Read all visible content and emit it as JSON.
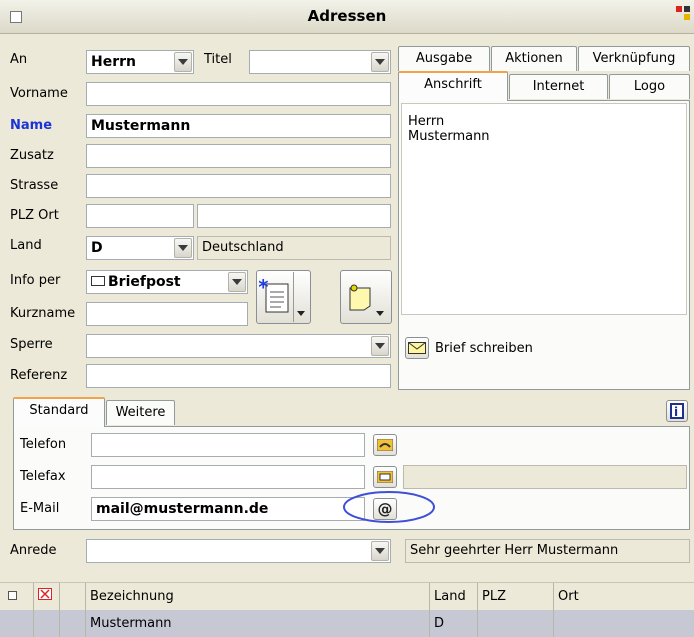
{
  "window": {
    "title": "Adressen"
  },
  "form": {
    "an_label": "An",
    "an_value": "Herrn",
    "titel_label": "Titel",
    "titel_value": "",
    "vorname_label": "Vorname",
    "vorname_value": "",
    "name_label": "Name",
    "name_value": "Mustermann",
    "zusatz_label": "Zusatz",
    "zusatz_value": "",
    "strasse_label": "Strasse",
    "strasse_value": "",
    "plzort_label": "PLZ  Ort",
    "plz_value": "",
    "ort_value": "",
    "land_label": "Land",
    "land_code": "D",
    "land_name": "Deutschland",
    "infoper_label": "Info per",
    "infoper_value": "Briefpost",
    "kurzname_label": "Kurzname",
    "kurzname_value": "",
    "sperre_label": "Sperre",
    "sperre_value": "",
    "referenz_label": "Referenz",
    "referenz_value": ""
  },
  "right_tabs": {
    "row1": [
      "Ausgabe",
      "Aktionen",
      "Verknüpfung"
    ],
    "row2": [
      "Anschrift",
      "Internet",
      "Logo"
    ],
    "address_lines": [
      "Herrn",
      "Mustermann"
    ],
    "brief_button": "Brief schreiben"
  },
  "contact": {
    "tabs": [
      "Standard",
      "Weitere"
    ],
    "telefon_label": "Telefon",
    "telefon_value": "",
    "telefax_label": "Telefax",
    "telefax_value": "",
    "email_label": "E-Mail",
    "email_value": "mail@mustermann.de"
  },
  "anrede": {
    "label": "Anrede",
    "value": "",
    "salutation": "Sehr geehrter Herr Mustermann"
  },
  "grid": {
    "headers": [
      "Bezeichnung",
      "Land",
      "PLZ",
      "Ort"
    ],
    "rows": [
      {
        "bezeichnung": "Mustermann",
        "land": "D",
        "plz": "",
        "ort": ""
      }
    ]
  },
  "colors": {
    "accent_tab": "#f2a24b",
    "name_label": "#1c33d6",
    "highlight_circle": "#3f4fd6"
  }
}
